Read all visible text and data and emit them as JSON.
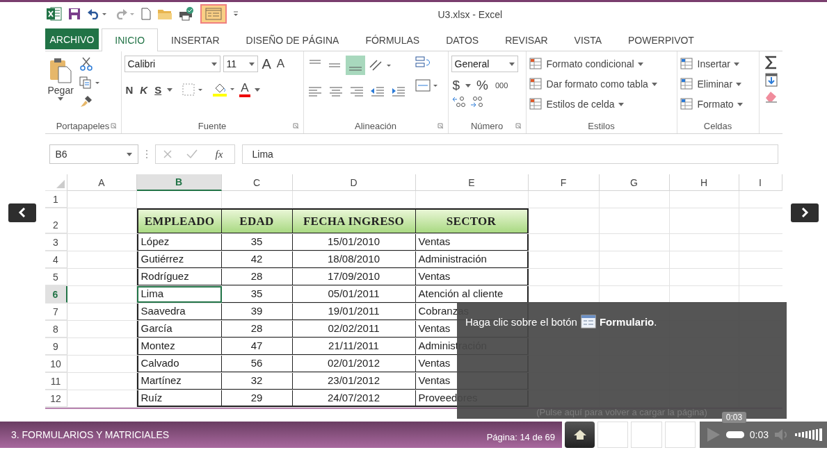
{
  "window": {
    "title": "U3.xlsx - Excel",
    "form_button_highlighted": true
  },
  "tabs": [
    {
      "label": "ARCHIVO",
      "kind": "file",
      "selected": false
    },
    {
      "label": "INICIO",
      "kind": "tab",
      "selected": true
    },
    {
      "label": "INSERTAR",
      "kind": "tab",
      "selected": false
    },
    {
      "label": "DISEÑO DE PÁGINA",
      "kind": "tab",
      "selected": false
    },
    {
      "label": "FÓRMULAS",
      "kind": "tab",
      "selected": false
    },
    {
      "label": "DATOS",
      "kind": "tab",
      "selected": false
    },
    {
      "label": "REVISAR",
      "kind": "tab",
      "selected": false
    },
    {
      "label": "VISTA",
      "kind": "tab",
      "selected": false
    },
    {
      "label": "POWERPIVOT",
      "kind": "tab",
      "selected": false
    }
  ],
  "ribbon": {
    "groups": [
      {
        "kind": "clipboard",
        "label": "Portapapeles",
        "paste": "Pegar"
      },
      {
        "kind": "font",
        "label": "Fuente",
        "font_name": "Calibri",
        "font_size": "11",
        "grow": "A",
        "shrink": "A",
        "bold": "N",
        "italic": "K",
        "underline": "S",
        "font_color": "A"
      },
      {
        "kind": "alignment",
        "label": "Alineación"
      },
      {
        "kind": "number",
        "label": "Número",
        "format": "General",
        "currency": "$",
        "percent": "%",
        "thousands": "000"
      },
      {
        "kind": "styles",
        "label": "Estilos",
        "items": [
          "Formato condicional",
          "Dar formato como tabla",
          "Estilos de celda"
        ]
      },
      {
        "kind": "cells",
        "label": "Celdas",
        "items": [
          "Insertar",
          "Eliminar",
          "Formato"
        ]
      },
      {
        "kind": "editing"
      }
    ]
  },
  "formula_bar": {
    "name_box": "B6",
    "function_symbol": "fx",
    "value": "Lima"
  },
  "sheet": {
    "columns": [
      {
        "label": "A",
        "selected": false
      },
      {
        "label": "B",
        "selected": true
      },
      {
        "label": "C",
        "selected": false
      },
      {
        "label": "D",
        "selected": false
      },
      {
        "label": "E",
        "selected": false
      },
      {
        "label": "F",
        "selected": false
      },
      {
        "label": "G",
        "selected": false
      },
      {
        "label": "H",
        "selected": false
      },
      {
        "label": "I",
        "selected": false
      }
    ],
    "rows": [
      {
        "label": "1",
        "kind": "blank",
        "selected": false
      },
      {
        "label": "2",
        "kind": "header",
        "selected": false,
        "cells": [
          "EMPLEADO",
          "EDAD",
          "FECHA INGRESO",
          "SECTOR"
        ]
      },
      {
        "label": "3",
        "kind": "data",
        "selected": false,
        "cells": [
          "López",
          "35",
          "15/01/2010",
          "Ventas"
        ]
      },
      {
        "label": "4",
        "kind": "data",
        "selected": false,
        "cells": [
          "Gutiérrez",
          "42",
          "18/08/2010",
          "Administración"
        ]
      },
      {
        "label": "5",
        "kind": "data",
        "selected": false,
        "cells": [
          "Rodríguez",
          "28",
          "17/09/2010",
          "Ventas"
        ]
      },
      {
        "label": "6",
        "kind": "data",
        "selected": true,
        "cells": [
          "Lima",
          "35",
          "05/01/2011",
          "Atención al cliente"
        ]
      },
      {
        "label": "7",
        "kind": "data",
        "selected": false,
        "cells": [
          "Saavedra",
          "39",
          "19/01/2011",
          "Cobranzas"
        ]
      },
      {
        "label": "8",
        "kind": "data",
        "selected": false,
        "cells": [
          "García",
          "28",
          "02/02/2011",
          "Ventas"
        ]
      },
      {
        "label": "9",
        "kind": "data",
        "selected": false,
        "cells": [
          "Montez",
          "47",
          "21/11/2011",
          "Administración"
        ]
      },
      {
        "label": "10",
        "kind": "data",
        "selected": false,
        "cells": [
          "Calvado",
          "56",
          "02/01/2012",
          "Ventas"
        ]
      },
      {
        "label": "11",
        "kind": "data",
        "selected": false,
        "cells": [
          "Martínez",
          "32",
          "23/01/2012",
          "Ventas"
        ]
      },
      {
        "label": "12",
        "kind": "data",
        "selected": false,
        "cells": [
          "Ruíz",
          "29",
          "24/07/2012",
          "Proveedores"
        ]
      }
    ]
  },
  "instruction": {
    "text": "Haga clic sobre el botón",
    "button": "**Formulario**.",
    "reload_hint": "(Pulse aquí para volver a cargar la página)"
  },
  "footer": {
    "course_title": "3. FORMULARIOS Y MATRICIALES",
    "page": "Página: 14 de 69"
  },
  "player": {
    "tooltip": "0:03",
    "time": "0:03",
    "seek": {
      "level": 1
    }
  }
}
